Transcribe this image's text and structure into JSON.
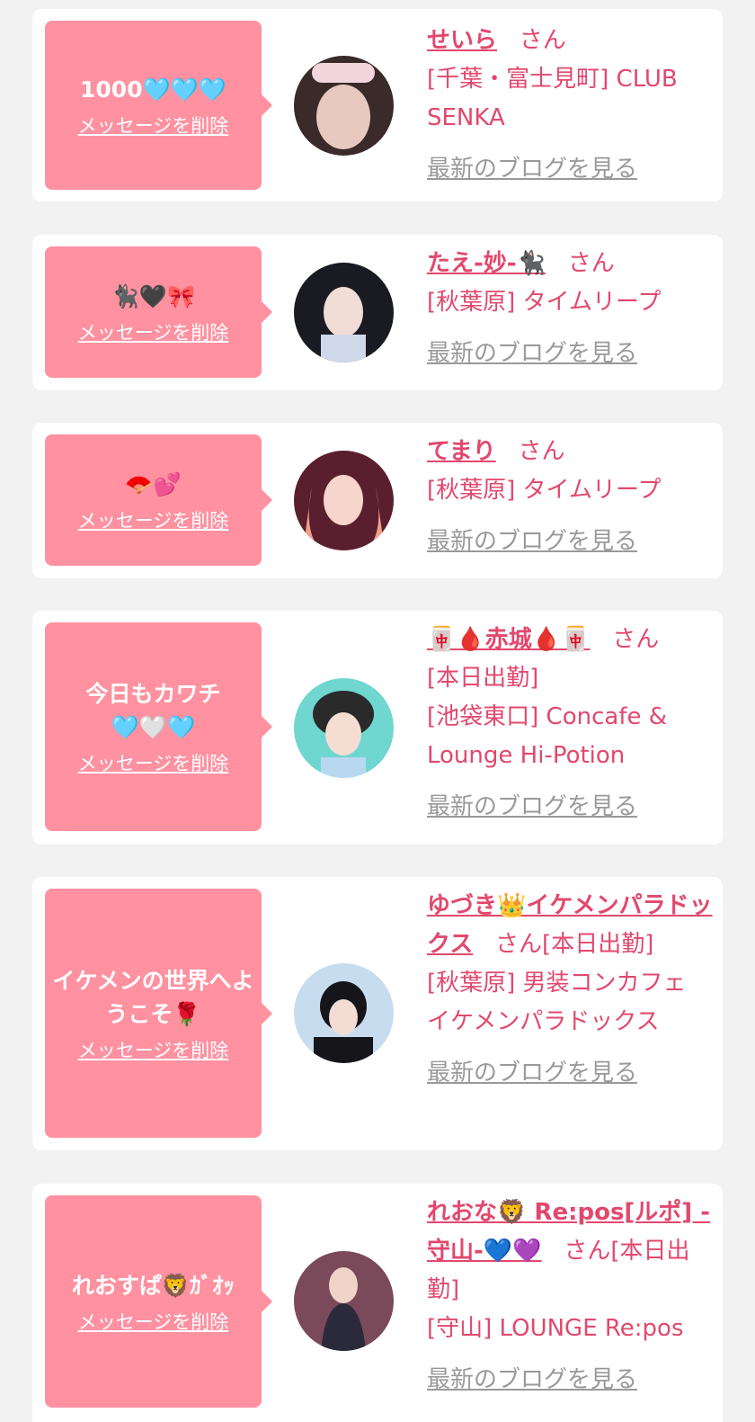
{
  "delete_label": "メッセージを削除",
  "blog_label": "最新のブログを見る",
  "san_label": "さん",
  "cards": [
    {
      "message": "1000🩵🩵🩵",
      "name": "せいら",
      "lines": [
        "[千葉・富士見町] CLUB SENKA"
      ],
      "avatar_colors": [
        "#3a2a2a",
        "#e8c9c0"
      ]
    },
    {
      "message": "🐈‍⬛🖤🎀",
      "name": "たえ-妙-🐈‍⬛",
      "lines": [
        "[秋葉原] タイムリープ"
      ],
      "avatar_colors": [
        "#1a1a22",
        "#cfd8e8"
      ]
    },
    {
      "message": "🪭💕",
      "name": "てまり",
      "lines": [
        "[秋葉原] タイムリープ"
      ],
      "avatar_colors": [
        "#5a1f2e",
        "#f0a08a"
      ]
    },
    {
      "message": "今日もカワチ🩵🤍🩵",
      "name": "🀄🩸赤城🩸🀄",
      "lines": [
        "[本日出勤]",
        "[池袋東口] Concafe & Lounge Hi-Potion"
      ],
      "avatar_colors": [
        "#2a2a2a",
        "#6fd6d0"
      ]
    },
    {
      "message": "イケメンの世界へようこそ🌹",
      "name": "ゆづき👑イケメンパラドックス",
      "lines": [
        "[本日出勤]",
        "[秋葉原] 男装コンカフェ イケメンパラドックス"
      ],
      "avatar_colors": [
        "#15151a",
        "#c8dcf0"
      ]
    },
    {
      "message": "れおすぱ🦁ｶﾞｵｯ",
      "name": "れおな🦁 Re:pos[ルポ] -守山-💙💜",
      "lines": [
        "[本日出勤]",
        "[守山] LOUNGE Re:pos"
      ],
      "avatar_colors": [
        "#2a2a3a",
        "#7a4a5a"
      ]
    }
  ]
}
